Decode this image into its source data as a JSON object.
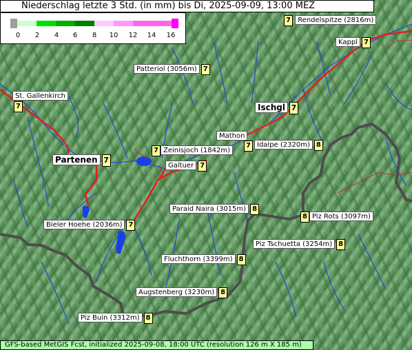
{
  "title": "Niederschlag letzte 3 Std. (in mm) bis Di, 2025-09-09, 13:00 MEZ",
  "legend": {
    "ticks": [
      "0",
      "2",
      "4",
      "6",
      "8",
      "10",
      "12",
      "14",
      "16"
    ],
    "colors": [
      "#9e9e9e",
      "#ccffcc",
      "#00e000",
      "#00b000",
      "#008000",
      "#ffccff",
      "#ff99ff",
      "#ff66ee",
      "#ff00ff"
    ]
  },
  "places": {
    "rendelspitze": {
      "name": "Rendelspitze (2816m)",
      "value": "7"
    },
    "kappl": {
      "name": "Kappl",
      "value": "7"
    },
    "patteriol": {
      "name": "Patteriol (3056m)",
      "value": "7"
    },
    "st_gallenkirch": {
      "name": "St. Gallenkirch",
      "value": "7"
    },
    "ischgl": {
      "name": "Ischgl",
      "value": "7"
    },
    "mathon": {
      "name": "Mathon",
      "value": "7"
    },
    "idalpe": {
      "name": "Idalpe (2320m)",
      "value": "8"
    },
    "zeinisjoch": {
      "name": "Zeinisjoch (1842m)",
      "value": "7"
    },
    "partenen": {
      "name": "Partenen",
      "value": "7"
    },
    "galtuer": {
      "name": "Galtuer",
      "value": "7"
    },
    "paraid_naira": {
      "name": "Paraid Naira (3015m)",
      "value": "8"
    },
    "piz_rots": {
      "name": "Piz Rots (3097m)",
      "value": "8"
    },
    "bieler_hoehe": {
      "name": "Bieler Hoehe (2036m)",
      "value": "7"
    },
    "piz_tschuetta": {
      "name": "Piz Tschuetta (3254m)",
      "value": "8"
    },
    "fluchthorn": {
      "name": "Fluchthorn (3399m)",
      "value": "8"
    },
    "augstenberg": {
      "name": "Augstenberg (3230m)",
      "value": "8"
    },
    "piz_buin": {
      "name": "Piz Buin (3312m)",
      "value": "8"
    }
  },
  "footer": "GFS-based MetGIS Fcst, initialized 2025-09-08, 18:00 UTC  (resolution 126 m X 185 m)"
}
